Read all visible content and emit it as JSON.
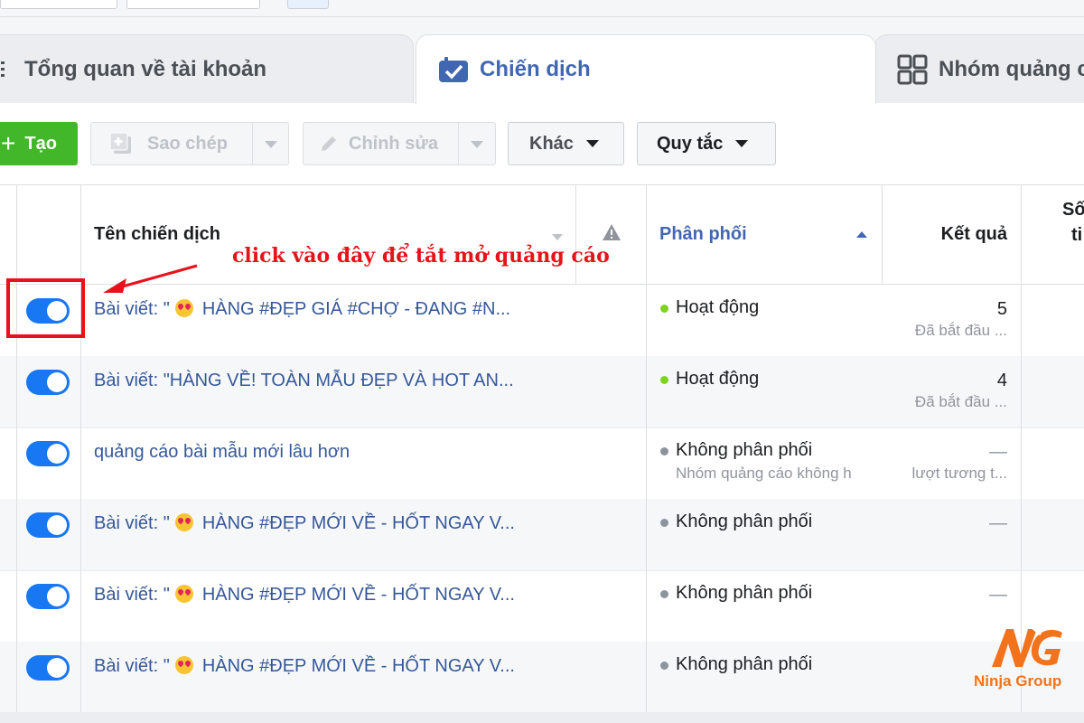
{
  "tabs": [
    {
      "label": "Tổng quan về tài khoản",
      "icon": "list-icon"
    },
    {
      "label": "Chiến dịch",
      "icon": "checkbox-icon",
      "active": true
    },
    {
      "label": "Nhóm quảng c",
      "icon": "grid-icon"
    }
  ],
  "toolbar": {
    "create": "Tạo",
    "copy": "Sao chép",
    "edit": "Chỉnh sửa",
    "more": "Khác",
    "rules": "Quy tắc"
  },
  "table": {
    "headers": {
      "name": "Tên chiến dịch",
      "delivery": "Phân phối",
      "results": "Kết quả",
      "col5_line1": "Số",
      "col5_line2": "ti"
    },
    "rows": [
      {
        "name_prefix": "Bài viết: \"",
        "emoji": true,
        "name": "HÀNG #ĐẸP GIÁ #CHỢ - ĐANG #N...",
        "status": "Hoạt động",
        "status_color": "#7ed321",
        "substatus": "",
        "result": "5",
        "result_sub": "Đã bắt đầu ..."
      },
      {
        "name_prefix": "Bài viết: \"HÀNG VỀ! TOÀN MẪU ĐẸP VÀ HOT AN...",
        "emoji": false,
        "name": "",
        "status": "Hoạt động",
        "status_color": "#7ed321",
        "substatus": "",
        "result": "4",
        "result_sub": "Đã bắt đầu ..."
      },
      {
        "name_prefix": "quảng cáo bài mẫu mới lâu hơn",
        "emoji": false,
        "name": "",
        "status": "Không phân phối",
        "status_color": "#8d949e",
        "substatus": "Nhóm quảng cáo không h",
        "result": "—",
        "result_sub": "lượt tương t..."
      },
      {
        "name_prefix": "Bài viết: \"",
        "emoji": true,
        "name": "HÀNG #ĐẸP MỚI VỀ - HỐT NGAY V...",
        "status": "Không phân phối",
        "status_color": "#8d949e",
        "substatus": "",
        "result": "—",
        "result_sub": ""
      },
      {
        "name_prefix": "Bài viết: \"",
        "emoji": true,
        "name": "HÀNG #ĐẸP MỚI VỀ - HỐT NGAY V...",
        "status": "Không phân phối",
        "status_color": "#8d949e",
        "substatus": "",
        "result": "—",
        "result_sub": ""
      },
      {
        "name_prefix": "Bài viết: \"",
        "emoji": true,
        "name": "HÀNG #ĐẸP MỚI VỀ - HỐT NGAY V...",
        "status": "Không phân phối",
        "status_color": "#8d949e",
        "substatus": "",
        "result": "",
        "result_sub": ""
      }
    ]
  },
  "annotation": {
    "text": "click vào đây để tắt mở quảng cáo"
  },
  "watermark": {
    "brand": "Ninja Group"
  },
  "colors": {
    "primary": "#4267b2",
    "toggle": "#1877f2",
    "create": "#42b72a",
    "annotation": "#e8121a"
  }
}
